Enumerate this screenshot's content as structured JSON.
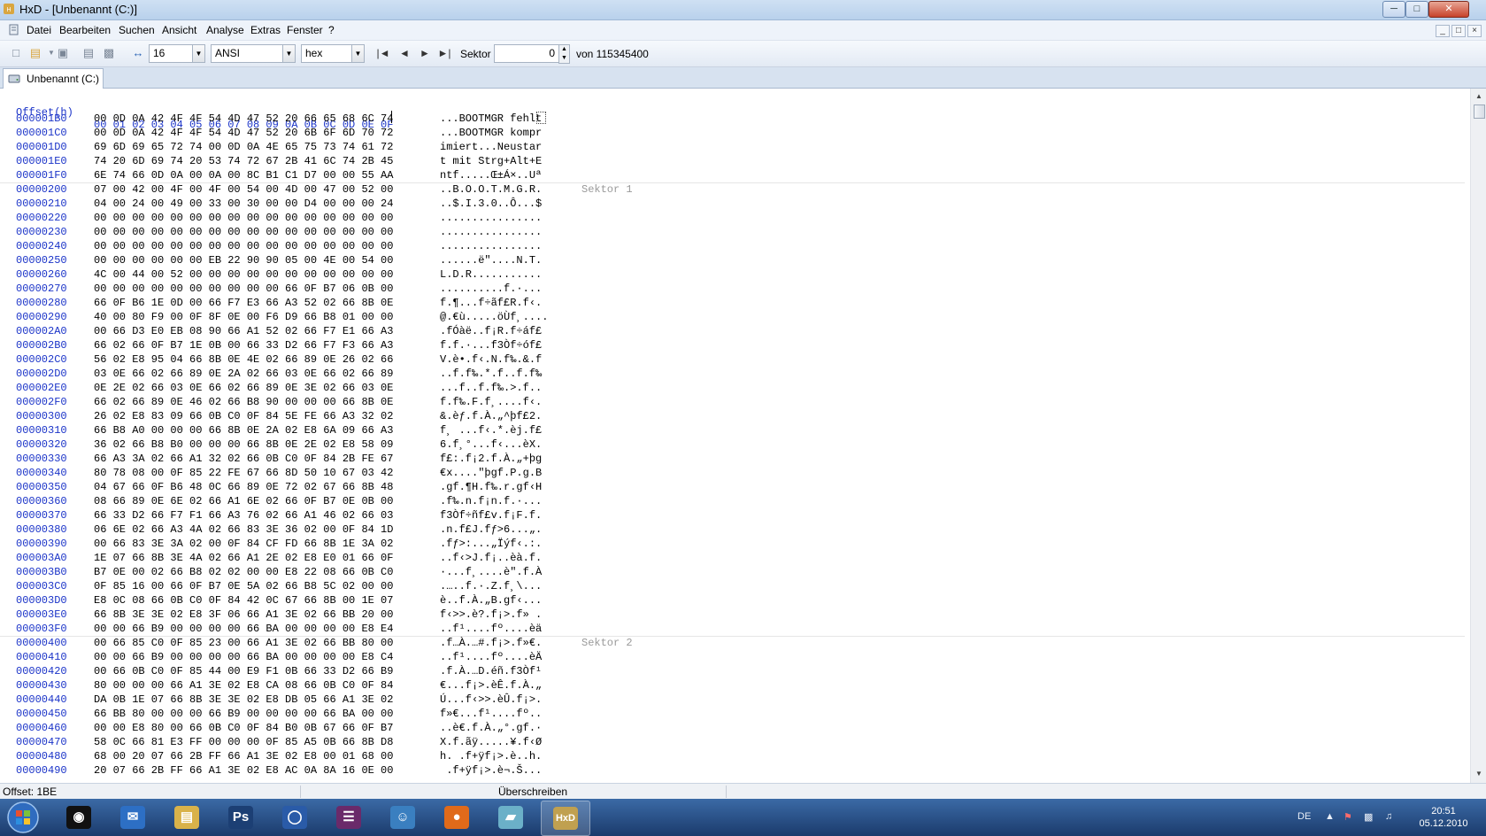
{
  "window": {
    "title": "HxD - [Unbenannt (C:)]",
    "minimize_glyph": "─",
    "maximize_glyph": "□",
    "close_glyph": "✕"
  },
  "menu": [
    "Datei",
    "Bearbeiten",
    "Suchen",
    "Ansicht",
    "Analyse",
    "Extras",
    "Fenster",
    "?"
  ],
  "mdi": {
    "min": "_",
    "restore": "□",
    "close": "×"
  },
  "toolbar": {
    "bytes_per_row": "16",
    "charset": "ANSI",
    "offset_base": "hex",
    "sector_label": "Sektor",
    "sector_value": "0",
    "sector_total": "von 115345400",
    "nav_first": "|◄",
    "nav_prev": "◄",
    "nav_next": "►",
    "nav_last": "►|"
  },
  "tab": {
    "label": "Unbenannt (C:)"
  },
  "editor": {
    "header_offset": "Offset(h)",
    "header_cols": "00 01 02 03 04 05 06 07 08 09 0A 0B 0C 0D 0E 0F",
    "sector_labels": [
      "Sektor 1",
      "Sektor 2"
    ],
    "rows": [
      {
        "o": "000001B0",
        "h": "00 0D 0A 42 4F 4F 54 4D 47 52 20 66 65 68 6C 74",
        "a": "...BOOTMGR fehlt"
      },
      {
        "o": "000001C0",
        "h": "00 0D 0A 42 4F 4F 54 4D 47 52 20 6B 6F 6D 70 72",
        "a": "...BOOTMGR kompr"
      },
      {
        "o": "000001D0",
        "h": "69 6D 69 65 72 74 00 0D 0A 4E 65 75 73 74 61 72",
        "a": "imiert...Neustar"
      },
      {
        "o": "000001E0",
        "h": "74 20 6D 69 74 20 53 74 72 67 2B 41 6C 74 2B 45",
        "a": "t mit Strg+Alt+E"
      },
      {
        "o": "000001F0",
        "h": "6E 74 66 0D 0A 00 0A 00 8C B1 C1 D7 00 00 55 AA",
        "a": "ntf.....Œ±Á×..Uª"
      },
      {
        "o": "00000200",
        "h": "07 00 42 00 4F 00 4F 00 54 00 4D 00 47 00 52 00",
        "a": "..B.O.O.T.M.G.R."
      },
      {
        "o": "00000210",
        "h": "04 00 24 00 49 00 33 00 30 00 00 D4 00 00 00 24",
        "a": "..$.I.3.0..Ô...$"
      },
      {
        "o": "00000220",
        "h": "00 00 00 00 00 00 00 00 00 00 00 00 00 00 00 00",
        "a": "................"
      },
      {
        "o": "00000230",
        "h": "00 00 00 00 00 00 00 00 00 00 00 00 00 00 00 00",
        "a": "................"
      },
      {
        "o": "00000240",
        "h": "00 00 00 00 00 00 00 00 00 00 00 00 00 00 00 00",
        "a": "................"
      },
      {
        "o": "00000250",
        "h": "00 00 00 00 00 00 EB 22 90 90 05 00 4E 00 54 00",
        "a": "......ë\"....N.T."
      },
      {
        "o": "00000260",
        "h": "4C 00 44 00 52 00 00 00 00 00 00 00 00 00 00 00",
        "a": "L.D.R..........."
      },
      {
        "o": "00000270",
        "h": "00 00 00 00 00 00 00 00 00 00 66 0F B7 06 0B 00",
        "a": "..........f.·..."
      },
      {
        "o": "00000280",
        "h": "66 0F B6 1E 0D 00 66 F7 E3 66 A3 52 02 66 8B 0E",
        "a": "f.¶...f÷ãf£R.f‹."
      },
      {
        "o": "00000290",
        "h": "40 00 80 F9 00 0F 8F 0E 00 F6 D9 66 B8 01 00 00",
        "a": "@.€ù.....öÙf¸...."
      },
      {
        "o": "000002A0",
        "h": "00 66 D3 E0 EB 08 90 66 A1 52 02 66 F7 E1 66 A3",
        "a": ".fÓàë..f¡R.f÷áf£"
      },
      {
        "o": "000002B0",
        "h": "66 02 66 0F B7 1E 0B 00 66 33 D2 66 F7 F3 66 A3",
        "a": "f.f.·...f3Òf÷óf£"
      },
      {
        "o": "000002C0",
        "h": "56 02 E8 95 04 66 8B 0E 4E 02 66 89 0E 26 02 66",
        "a": "V.è•.f‹.N.f‰.&.f"
      },
      {
        "o": "000002D0",
        "h": "03 0E 66 02 66 89 0E 2A 02 66 03 0E 66 02 66 89",
        "a": "..f.f‰.*.f..f.f‰"
      },
      {
        "o": "000002E0",
        "h": "0E 2E 02 66 03 0E 66 02 66 89 0E 3E 02 66 03 0E",
        "a": "...f..f.f‰.>.f.."
      },
      {
        "o": "000002F0",
        "h": "66 02 66 89 0E 46 02 66 B8 90 00 00 00 66 8B 0E",
        "a": "f.f‰.F.f¸....f‹."
      },
      {
        "o": "00000300",
        "h": "26 02 E8 83 09 66 0B C0 0F 84 5E FE 66 A3 32 02",
        "a": "&.èƒ.f.À.„^þf£2."
      },
      {
        "o": "00000310",
        "h": "66 B8 A0 00 00 00 66 8B 0E 2A 02 E8 6A 09 66 A3",
        "a": "f¸ ...f‹.*.èj.f£"
      },
      {
        "o": "00000320",
        "h": "36 02 66 B8 B0 00 00 00 66 8B 0E 2E 02 E8 58 09",
        "a": "6.f¸°...f‹...èX."
      },
      {
        "o": "00000330",
        "h": "66 A3 3A 02 66 A1 32 02 66 0B C0 0F 84 2B FE 67",
        "a": "f£:.f¡2.f.À.„+þg"
      },
      {
        "o": "00000340",
        "h": "80 78 08 00 0F 85 22 FE 67 66 8D 50 10 67 03 42",
        "a": "€x....\"þgf.P.g.B"
      },
      {
        "o": "00000350",
        "h": "04 67 66 0F B6 48 0C 66 89 0E 72 02 67 66 8B 48",
        "a": ".gf.¶H.f‰.r.gf‹H"
      },
      {
        "o": "00000360",
        "h": "08 66 89 0E 6E 02 66 A1 6E 02 66 0F B7 0E 0B 00",
        "a": ".f‰.n.f¡n.f.·..."
      },
      {
        "o": "00000370",
        "h": "66 33 D2 66 F7 F1 66 A3 76 02 66 A1 46 02 66 03",
        "a": "f3Òf÷ñf£v.f¡F.f."
      },
      {
        "o": "00000380",
        "h": "06 6E 02 66 A3 4A 02 66 83 3E 36 02 00 0F 84 1D",
        "a": ".n.f£J.fƒ>6...„."
      },
      {
        "o": "00000390",
        "h": "00 66 83 3E 3A 02 00 0F 84 CF FD 66 8B 1E 3A 02",
        "a": ".fƒ>:...„Ïýf‹.:."
      },
      {
        "o": "000003A0",
        "h": "1E 07 66 8B 3E 4A 02 66 A1 2E 02 E8 E0 01 66 0F",
        "a": "..f‹>J.f¡..èà.f."
      },
      {
        "o": "000003B0",
        "h": "B7 0E 00 02 66 B8 02 02 00 00 E8 22 08 66 0B C0",
        "a": "·...f¸....è\".f.À"
      },
      {
        "o": "000003C0",
        "h": "0F 85 16 00 66 0F B7 0E 5A 02 66 B8 5C 02 00 00",
        "a": ".…..f.·.Z.f¸\\..."
      },
      {
        "o": "000003D0",
        "h": "E8 0C 08 66 0B C0 0F 84 42 0C 67 66 8B 00 1E 07",
        "a": "è..f.À.„B.gf‹..."
      },
      {
        "o": "000003E0",
        "h": "66 8B 3E 3E 02 E8 3F 06 66 A1 3E 02 66 BB 20 00",
        "a": "f‹>>.è?.f¡>.f» ."
      },
      {
        "o": "000003F0",
        "h": "00 00 66 B9 00 00 00 00 66 BA 00 00 00 00 E8 E4",
        "a": "..f¹....fº....èä"
      },
      {
        "o": "00000400",
        "h": "00 66 85 C0 0F 85 23 00 66 A1 3E 02 66 BB 80 00",
        "a": ".f…À.…#.f¡>.f»€."
      },
      {
        "o": "00000410",
        "h": "00 00 66 B9 00 00 00 00 66 BA 00 00 00 00 E8 C4",
        "a": "..f¹....fº....èÄ"
      },
      {
        "o": "00000420",
        "h": "00 66 0B C0 0F 85 44 00 E9 F1 0B 66 33 D2 66 B9",
        "a": ".f.À.…D.éñ.f3Òf¹"
      },
      {
        "o": "00000430",
        "h": "80 00 00 00 66 A1 3E 02 E8 CA 08 66 0B C0 0F 84",
        "a": "€...f¡>.èÊ.f.À.„"
      },
      {
        "o": "00000440",
        "h": "DA 0B 1E 07 66 8B 3E 3E 02 E8 DB 05 66 A1 3E 02",
        "a": "Ú...f‹>>.èÛ.f¡>."
      },
      {
        "o": "00000450",
        "h": "66 BB 80 00 00 00 66 B9 00 00 00 00 66 BA 00 00",
        "a": "f»€...f¹....fº.."
      },
      {
        "o": "00000460",
        "h": "00 00 E8 80 00 66 0B C0 0F 84 B0 0B 67 66 0F B7",
        "a": "..è€.f.À.„°.gf.·"
      },
      {
        "o": "00000470",
        "h": "58 0C 66 81 E3 FF 00 00 00 0F 85 A5 0B 66 8B D8",
        "a": "X.f.ãÿ.....¥.f‹Ø"
      },
      {
        "o": "00000480",
        "h": "68 00 20 07 66 2B FF 66 A1 3E 02 E8 00 01 68 00",
        "a": "h. .f+ÿf¡>.è..h."
      },
      {
        "o": "00000490",
        "h": "20 07 66 2B FF 66 A1 3E 02 E8 AC 0A 8A 16 0E 00",
        "a": " .f+ÿf¡>.è¬.Š..."
      }
    ]
  },
  "scroll": {
    "up": "▲",
    "down": "▼"
  },
  "status": {
    "offset": "Offset: 1BE",
    "mode": "Überschreiben"
  },
  "taskbar": {
    "apps": [
      {
        "name": "steam",
        "glyph": "◉",
        "color": "#111111"
      },
      {
        "name": "thunderbird",
        "glyph": "✉",
        "color": "#2d6fc4"
      },
      {
        "name": "explorer",
        "glyph": "▤",
        "color": "#d9b24a"
      },
      {
        "name": "photoshop",
        "glyph": "Ps",
        "color": "#1c3f74"
      },
      {
        "name": "sphere",
        "glyph": "◯",
        "color": "#2a5ba8"
      },
      {
        "name": "winrar",
        "glyph": "☰",
        "color": "#6a2a6a"
      },
      {
        "name": "messenger",
        "glyph": "☺",
        "color": "#3a7fc0"
      },
      {
        "name": "firefox",
        "glyph": "●",
        "color": "#e06a1a"
      },
      {
        "name": "tool",
        "glyph": "▰",
        "color": "#6bb0c8"
      },
      {
        "name": "hxd",
        "glyph": "HxD",
        "color": "#c0a050"
      }
    ],
    "lang": "DE",
    "time": "20:51",
    "date": "05.12.2010"
  },
  "colors": {
    "offset_blue": "#1a33c8",
    "sector_gray": "#9a9a9a"
  }
}
